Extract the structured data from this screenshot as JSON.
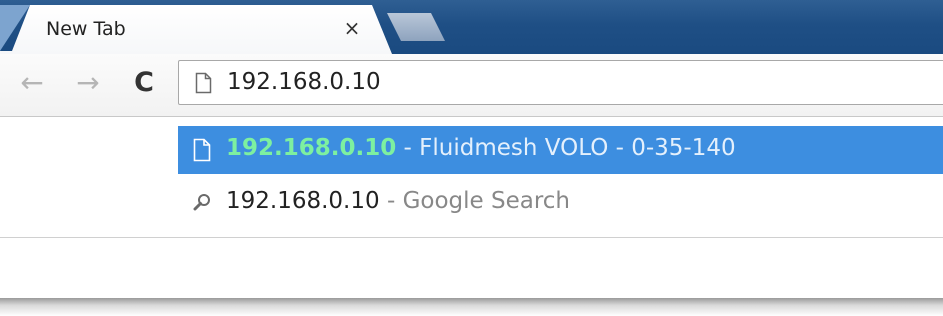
{
  "tabs": [
    {
      "title": "New Tab",
      "close_label": "×"
    }
  ],
  "toolbar": {
    "back_icon": "←",
    "forward_icon": "→",
    "reload_icon": "C"
  },
  "omnibox": {
    "value": "192.168.0.10",
    "icon": "page-icon"
  },
  "suggestions": [
    {
      "icon": "page-icon",
      "url": "192.168.0.10",
      "separator": " - ",
      "description": "Fluidmesh VOLO - 0-35-140",
      "selected": true
    },
    {
      "icon": "search-icon",
      "url": "192.168.0.10",
      "separator": " - ",
      "description": "Google Search",
      "selected": false
    }
  ],
  "colors": {
    "tabstrip": "#1f4f85",
    "selected_row": "#3d8ee0",
    "selected_url": "#7df0a0"
  }
}
